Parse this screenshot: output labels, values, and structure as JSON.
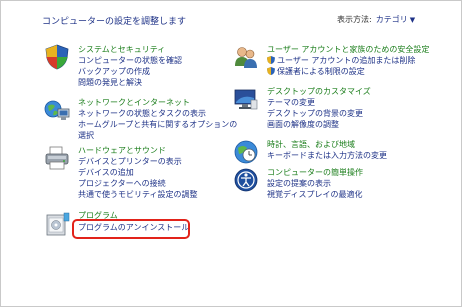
{
  "header": {
    "title": "コンピューターの設定を調整します",
    "view_by_label": "表示方法:",
    "view_by_value": "カテゴリ"
  },
  "categories": {
    "system": {
      "title": "システムとセキュリティ",
      "links": [
        "コンピューターの状態を確認",
        "バックアップの作成",
        "問題の発見と解決"
      ]
    },
    "network": {
      "title": "ネットワークとインターネット",
      "links": [
        "ネットワークの状態とタスクの表示",
        "ホームグループと共有に関するオプションの選択"
      ]
    },
    "hardware": {
      "title": "ハードウェアとサウンド",
      "links": [
        "デバイスとプリンターの表示",
        "デバイスの追加",
        "プロジェクターへの接続",
        "共通で使うモビリティ設定の調整"
      ]
    },
    "programs": {
      "title": "プログラム",
      "links": [
        "プログラムのアンインストール"
      ]
    },
    "users": {
      "title": "ユーザー アカウントと家族のための安全設定",
      "links": [
        "ユーザー アカウントの追加または削除",
        "保護者による制限の設定"
      ]
    },
    "appearance": {
      "title": "デスクトップのカスタマイズ",
      "links": [
        "テーマの変更",
        "デスクトップの背景の変更",
        "画面の解像度の調整"
      ]
    },
    "clock": {
      "title": "時計、言語、および地域",
      "links": [
        "キーボードまたは入力方法の変更"
      ]
    },
    "ease": {
      "title": "コンピューターの簡単操作",
      "links": [
        "設定の提案の表示",
        "視覚ディスプレイの最適化"
      ]
    }
  }
}
